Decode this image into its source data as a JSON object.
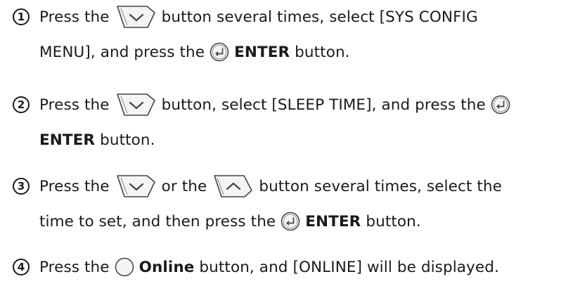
{
  "steps": [
    {
      "number": "1",
      "line1": {
        "before_icon": "Press the",
        "icon": "down-arrow-button-icon",
        "after_icon": "button several times, select [SYS CONFIG"
      },
      "line2": {
        "before_icon": "MENU], and press the",
        "icon": "enter-button-icon",
        "bold": "ENTER",
        "after_bold": "button."
      }
    },
    {
      "number": "2",
      "line1": {
        "before_icon": "Press the",
        "icon": "down-arrow-button-icon",
        "after_icon": "button, select [SLEEP TIME], and press the",
        "icon2": "enter-button-icon"
      },
      "line2": {
        "bold": "ENTER",
        "after_bold": "button."
      }
    },
    {
      "number": "3",
      "line1": {
        "before_icon": "Press the",
        "icon": "down-arrow-button-icon",
        "middle": "or the",
        "icon2": "up-arrow-button-icon",
        "after_icon": "button several times, select the"
      },
      "line2": {
        "before_icon": "time to set, and then press the",
        "icon": "enter-button-icon",
        "bold": "ENTER",
        "after_bold": "button."
      }
    },
    {
      "number": "4",
      "line1": {
        "before_icon": "Press the",
        "icon": "online-button-icon",
        "bold": "Online",
        "after_bold": "button, and [ONLINE] will be displayed."
      }
    }
  ],
  "colors": {
    "text": "#1a1a1a",
    "icon_stroke": "#444444",
    "icon_fill": "#f4f4f4"
  }
}
